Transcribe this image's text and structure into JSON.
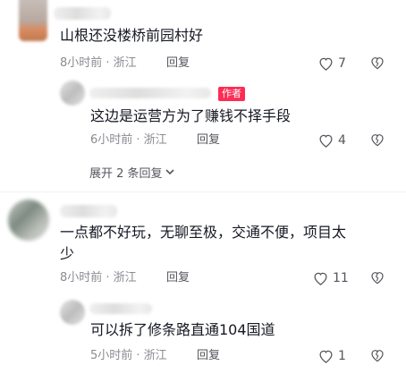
{
  "comment1": {
    "text": "山根还没楼桥前园村好",
    "time": "8小时前 · 浙江",
    "reply_label": "回复",
    "likes": "7",
    "reply": {
      "badge": "作者",
      "text": "这边是运营方为了赚钱不择手段",
      "time": "6小时前 · 浙江",
      "reply_label": "回复",
      "likes": "4"
    },
    "expand_label": "展开 2 条回复"
  },
  "comment2": {
    "text_line1": "一点都不好玩，无聊至极，交通不便，项目太",
    "text_line2": "少",
    "time": "8小时前 · 浙江",
    "reply_label": "回复",
    "likes": "11",
    "reply": {
      "text": "可以拆了修条路直通104国道",
      "time": "5小时前 · 浙江",
      "reply_label": "回复",
      "likes": "1"
    }
  },
  "icons": {
    "like": "heart-outline-icon",
    "dislike": "broken-heart-icon",
    "expand": "chevron-down-icon"
  },
  "colors": {
    "text": "#161823",
    "meta": "#8a8b91",
    "author_badge": "#fe2c55"
  }
}
